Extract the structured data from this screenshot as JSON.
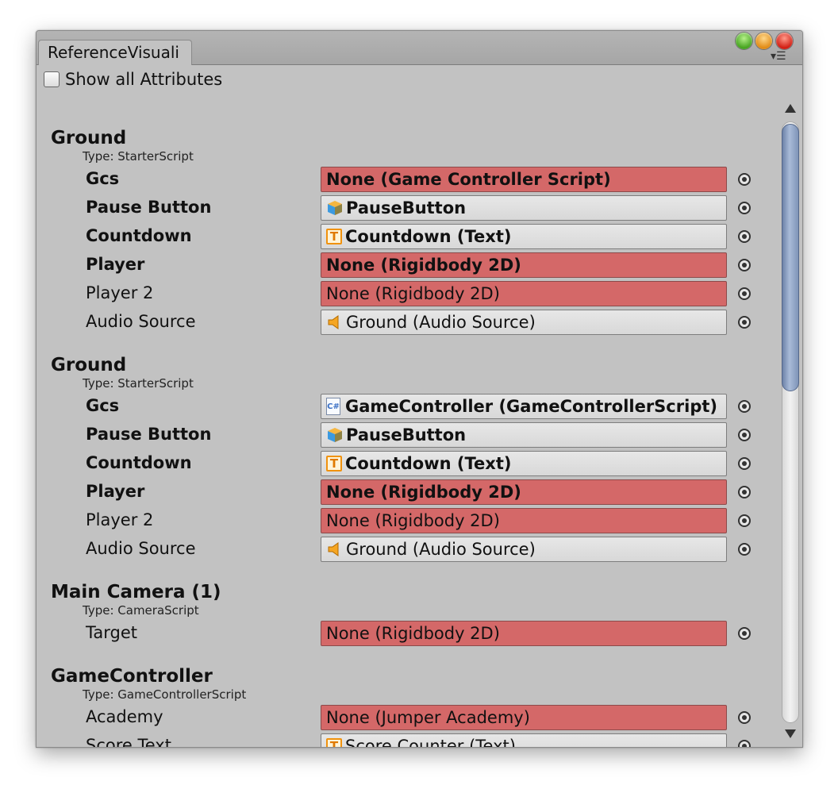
{
  "window": {
    "tab_title": "ReferenceVisuali",
    "menu_glyph": "▾☰"
  },
  "toolbar": {
    "show_all_label": "Show all Attributes",
    "show_all_checked": false
  },
  "groups": [
    {
      "title": "Ground",
      "type": "Type: StarterScript",
      "fields": [
        {
          "label": "Gcs",
          "value": "None (Game Controller Script)"
        },
        {
          "label": "Pause Button",
          "value": "PauseButton"
        },
        {
          "label": "Countdown",
          "value": "Countdown (Text)",
          "icon_letter": "T"
        },
        {
          "label": "Player",
          "value": "None (Rigidbody 2D)"
        },
        {
          "label": "Player 2",
          "value": "None (Rigidbody 2D)"
        },
        {
          "label": "Audio Source",
          "value": "Ground (Audio Source)"
        }
      ]
    },
    {
      "title": "Ground",
      "type": "Type: StarterScript",
      "fields": [
        {
          "label": "Gcs",
          "value": "GameController (GameControllerScript)",
          "icon_letter": "C#"
        },
        {
          "label": "Pause Button",
          "value": "PauseButton"
        },
        {
          "label": "Countdown",
          "value": "Countdown (Text)",
          "icon_letter": "T"
        },
        {
          "label": "Player",
          "value": "None (Rigidbody 2D)"
        },
        {
          "label": "Player 2",
          "value": "None (Rigidbody 2D)"
        },
        {
          "label": "Audio Source",
          "value": "Ground (Audio Source)"
        }
      ]
    },
    {
      "title": "Main Camera (1)",
      "type": "Type: CameraScript",
      "fields": [
        {
          "label": "Target",
          "value": "None (Rigidbody 2D)"
        }
      ]
    },
    {
      "title": "GameController",
      "type": "Type: GameControllerScript",
      "fields": [
        {
          "label": "Academy",
          "value": "None (Jumper Academy)"
        },
        {
          "label": "Score Text",
          "value": "Score Counter (Text)",
          "icon_letter": "T"
        }
      ]
    }
  ],
  "colors": {
    "missing_reference": "#d46868",
    "panel_background": "#c2c2c2",
    "scrollbar_thumb": "#8ea2c4"
  },
  "icons": {
    "prefab": "cube-icon",
    "text": "text-component-icon",
    "script": "csharp-script-icon",
    "audio": "speaker-icon",
    "picker": "object-picker-icon"
  }
}
